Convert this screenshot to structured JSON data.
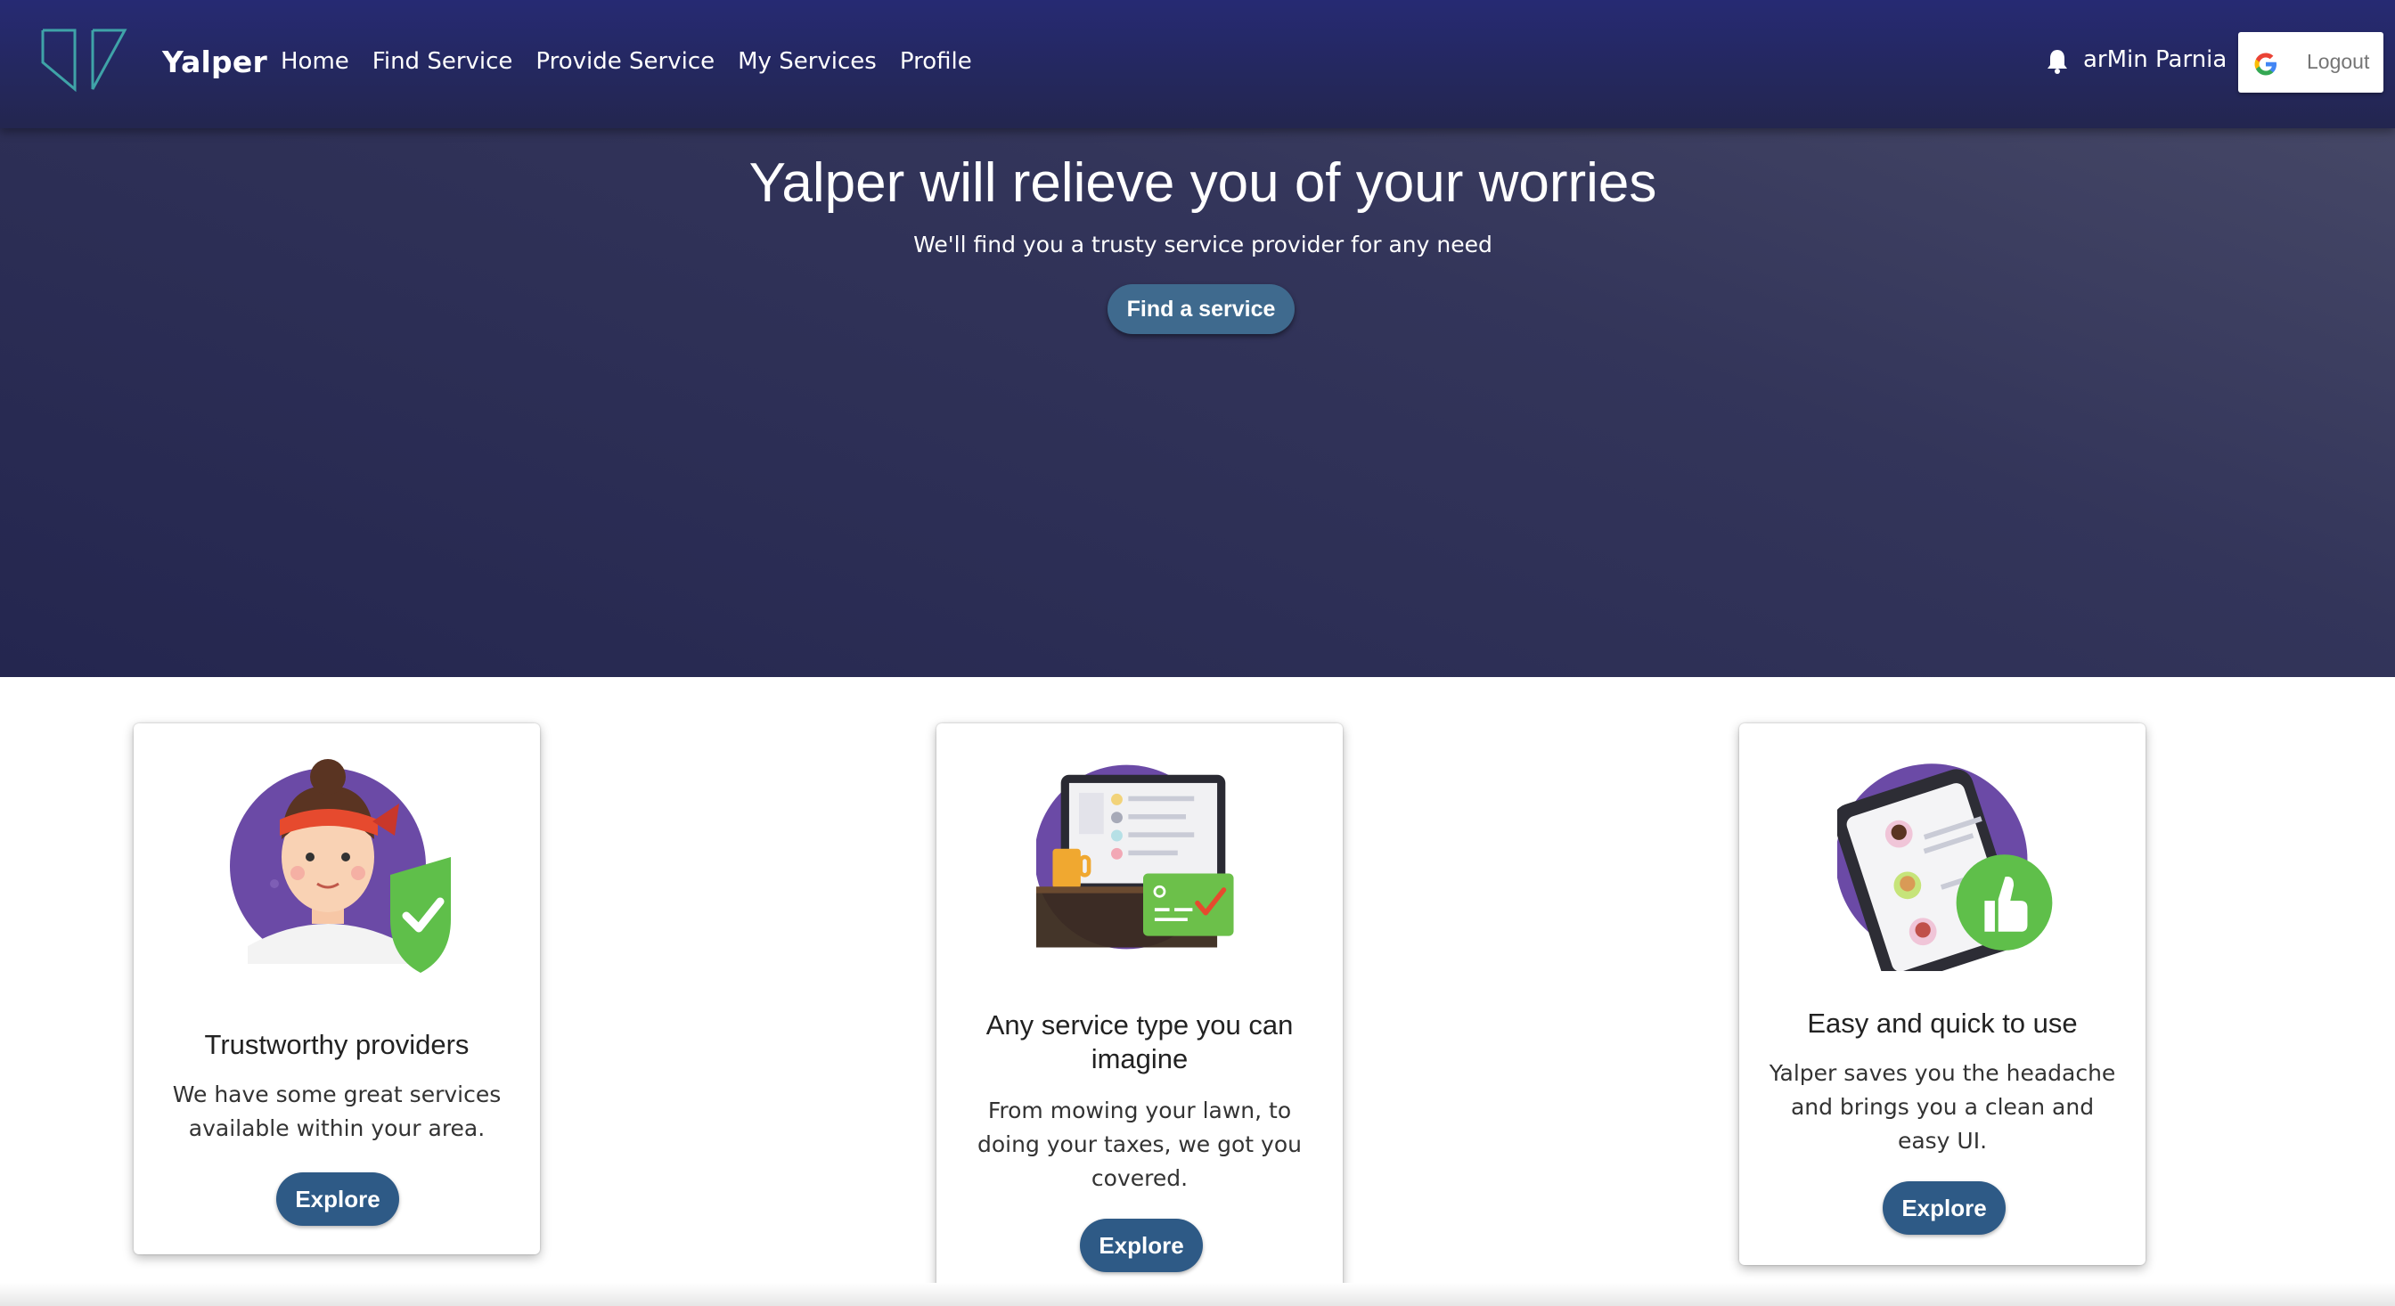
{
  "navbar": {
    "brand": "Yalper",
    "links": [
      "Home",
      "Find Service",
      "Provide Service",
      "My Services",
      "Profile"
    ],
    "user_name": "arMin Parnia",
    "logout_label": "Logout",
    "icons": {
      "logo": "yalper-logo",
      "bell": "bell-icon",
      "google": "google-icon"
    }
  },
  "hero": {
    "title": "Yalper will relieve you of your worries",
    "subtitle": "We'll find you a trusty service provider for any need",
    "button": "Find a service"
  },
  "cards": [
    {
      "title": "Trustworthy providers",
      "text": "We have some great services available within your area.",
      "button": "Explore",
      "illustration": "trusted-person-shield-illustration"
    },
    {
      "title": "Any service type you can imagine",
      "text": "From mowing your lawn, to doing your taxes, we got you covered.",
      "button": "Explore",
      "illustration": "laptop-services-illustration"
    },
    {
      "title": "Easy and quick to use",
      "text": "Yalper saves you the headache and brings you a clean and easy UI.",
      "button": "Explore",
      "illustration": "phone-thumbs-up-illustration"
    }
  ],
  "colors": {
    "nav_bg": "#262a73",
    "hero_bg": "#2c2e58",
    "button_bg": "#2e5a86",
    "hero_button_bg": "#3f6a8e",
    "illustration_purple": "#6b4aa6",
    "check_green": "#5fbf4a"
  }
}
